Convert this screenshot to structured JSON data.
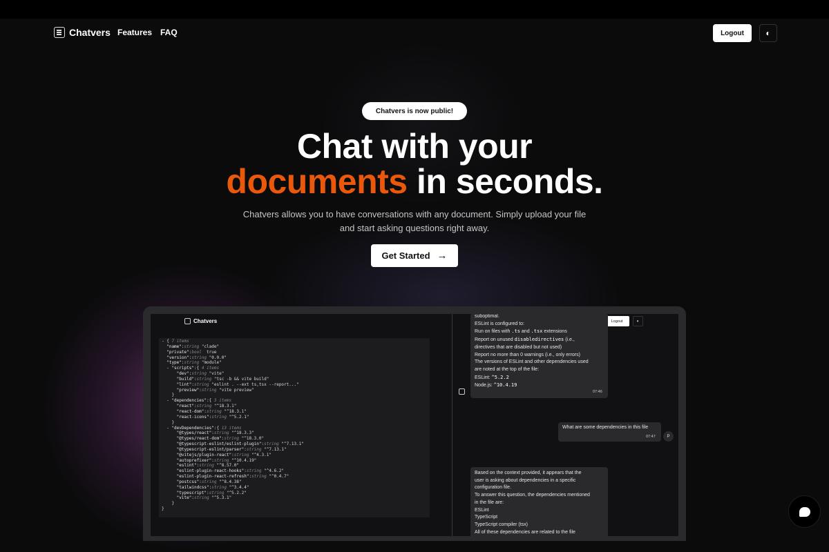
{
  "nav": {
    "brand": "Chatvers",
    "links": [
      "Features",
      "FAQ"
    ],
    "logout_label": "Logout",
    "theme_icon": "moon-sun-icon"
  },
  "hero": {
    "badge": "Chatvers is now public!",
    "title_line1": "Chat with your",
    "title_accent": "documents",
    "title_line2_rest": " in seconds.",
    "subtitle": "Chatvers allows you to have conversations with any document. Simply upload your file and start asking questions right away.",
    "cta_label": "Get Started",
    "accent_color": "#ea580c"
  },
  "preview": {
    "brand": "Chatvers",
    "logout_label": "Logout",
    "json_lines": [
      [
        {
          "c": "jl",
          "t": "- { "
        },
        {
          "c": "jc",
          "t": "7 items"
        }
      ],
      [
        {
          "c": "jk",
          "t": "  \"name\""
        },
        {
          "c": "jl",
          "t": ":"
        },
        {
          "c": "jt",
          "t": "string"
        },
        {
          "c": "jv",
          "t": "\"clade\""
        }
      ],
      [
        {
          "c": "jk",
          "t": "  \"private\""
        },
        {
          "c": "jl",
          "t": ":"
        },
        {
          "c": "jt",
          "t": "bool"
        },
        {
          "c": "jv",
          "t": " true"
        }
      ],
      [
        {
          "c": "jk",
          "t": "  \"version\""
        },
        {
          "c": "jl",
          "t": ":"
        },
        {
          "c": "jt",
          "t": "string"
        },
        {
          "c": "jv",
          "t": "\"0.0.0\""
        }
      ],
      [
        {
          "c": "jk",
          "t": "  \"type\""
        },
        {
          "c": "jl",
          "t": ":"
        },
        {
          "c": "jt",
          "t": "string"
        },
        {
          "c": "jv",
          "t": "\"module\""
        }
      ],
      [
        {
          "c": "jk",
          "t": "  - \"scripts\""
        },
        {
          "c": "jl",
          "t": ":{ "
        },
        {
          "c": "jc",
          "t": "4 items"
        }
      ],
      [
        {
          "c": "jk",
          "t": "      \"dev\""
        },
        {
          "c": "jl",
          "t": ":"
        },
        {
          "c": "jt",
          "t": "string"
        },
        {
          "c": "jv",
          "t": "\"vite\""
        }
      ],
      [
        {
          "c": "jk",
          "t": "      \"build\""
        },
        {
          "c": "jl",
          "t": ":"
        },
        {
          "c": "jt",
          "t": "string"
        },
        {
          "c": "jv",
          "t": "\"tsc -b && vite build\""
        }
      ],
      [
        {
          "c": "jk",
          "t": "      \"lint\""
        },
        {
          "c": "jl",
          "t": ":"
        },
        {
          "c": "jt",
          "t": "string"
        },
        {
          "c": "jv",
          "t": "\"eslint . --ext ts,tsx --report...\""
        }
      ],
      [
        {
          "c": "jk",
          "t": "      \"preview\""
        },
        {
          "c": "jl",
          "t": ":"
        },
        {
          "c": "jt",
          "t": "string"
        },
        {
          "c": "jv",
          "t": "\"vite preview\""
        }
      ],
      [
        {
          "c": "jl",
          "t": "    }"
        }
      ],
      [
        {
          "c": "jk",
          "t": "  - \"dependencies\""
        },
        {
          "c": "jl",
          "t": ":{ "
        },
        {
          "c": "jc",
          "t": "3 items"
        }
      ],
      [
        {
          "c": "jk",
          "t": "      \"react\""
        },
        {
          "c": "jl",
          "t": ":"
        },
        {
          "c": "jt",
          "t": "string"
        },
        {
          "c": "jv",
          "t": "\"^18.3.1\""
        }
      ],
      [
        {
          "c": "jk",
          "t": "      \"react-dom\""
        },
        {
          "c": "jl",
          "t": ":"
        },
        {
          "c": "jt",
          "t": "string"
        },
        {
          "c": "jv",
          "t": "\"^18.3.1\""
        }
      ],
      [
        {
          "c": "jk",
          "t": "      \"react-icons\""
        },
        {
          "c": "jl",
          "t": ":"
        },
        {
          "c": "jt",
          "t": "string"
        },
        {
          "c": "jv",
          "t": "\"^5.2.1\""
        }
      ],
      [
        {
          "c": "jl",
          "t": "    }"
        }
      ],
      [
        {
          "c": "jk",
          "t": "  - \"devDependencies\""
        },
        {
          "c": "jl",
          "t": ":{ "
        },
        {
          "c": "jc",
          "t": "13 items"
        }
      ],
      [
        {
          "c": "jk",
          "t": "      \"@types/react\""
        },
        {
          "c": "jl",
          "t": ":"
        },
        {
          "c": "jt",
          "t": "string"
        },
        {
          "c": "jv",
          "t": "\"^18.3.3\""
        }
      ],
      [
        {
          "c": "jk",
          "t": "      \"@types/react-dom\""
        },
        {
          "c": "jl",
          "t": ":"
        },
        {
          "c": "jt",
          "t": "string"
        },
        {
          "c": "jv",
          "t": "\"^18.3.0\""
        }
      ],
      [
        {
          "c": "jk",
          "t": "      \"@typescript-eslint/eslint-plugin\""
        },
        {
          "c": "jl",
          "t": ":"
        },
        {
          "c": "jt",
          "t": "string"
        },
        {
          "c": "jv",
          "t": "\"^7.13.1\""
        }
      ],
      [
        {
          "c": "jk",
          "t": "      \"@typescript-eslint/parser\""
        },
        {
          "c": "jl",
          "t": ":"
        },
        {
          "c": "jt",
          "t": "string"
        },
        {
          "c": "jv",
          "t": "\"^7.13.1\""
        }
      ],
      [
        {
          "c": "jk",
          "t": "      \"@vitejs/plugin-react\""
        },
        {
          "c": "jl",
          "t": ":"
        },
        {
          "c": "jt",
          "t": "string"
        },
        {
          "c": "jv",
          "t": "\"^4.3.1\""
        }
      ],
      [
        {
          "c": "jk",
          "t": "      \"autoprefixer\""
        },
        {
          "c": "jl",
          "t": ":"
        },
        {
          "c": "jt",
          "t": "string"
        },
        {
          "c": "jv",
          "t": "\"^10.4.19\""
        }
      ],
      [
        {
          "c": "jk",
          "t": "      \"eslint\""
        },
        {
          "c": "jl",
          "t": ":"
        },
        {
          "c": "jt",
          "t": "string"
        },
        {
          "c": "jv",
          "t": "\"^8.57.0\""
        }
      ],
      [
        {
          "c": "jk",
          "t": "      \"eslint-plugin-react-hooks\""
        },
        {
          "c": "jl",
          "t": ":"
        },
        {
          "c": "jt",
          "t": "string"
        },
        {
          "c": "jv",
          "t": "\"^4.6.2\""
        }
      ],
      [
        {
          "c": "jk",
          "t": "      \"eslint-plugin-react-refresh\""
        },
        {
          "c": "jl",
          "t": ":"
        },
        {
          "c": "jt",
          "t": "string"
        },
        {
          "c": "jv",
          "t": "\"^0.4.7\""
        }
      ],
      [
        {
          "c": "jk",
          "t": "      \"postcss\""
        },
        {
          "c": "jl",
          "t": ":"
        },
        {
          "c": "jt",
          "t": "string"
        },
        {
          "c": "jv",
          "t": "\"^8.4.38\""
        }
      ],
      [
        {
          "c": "jk",
          "t": "      \"tailwindcss\""
        },
        {
          "c": "jl",
          "t": ":"
        },
        {
          "c": "jt",
          "t": "string"
        },
        {
          "c": "jv",
          "t": "\"^3.4.4\""
        }
      ],
      [
        {
          "c": "jk",
          "t": "      \"typescript\""
        },
        {
          "c": "jl",
          "t": ":"
        },
        {
          "c": "jt",
          "t": "string"
        },
        {
          "c": "jv",
          "t": "\"^5.2.2\""
        }
      ],
      [
        {
          "c": "jk",
          "t": "      \"vite\""
        },
        {
          "c": "jl",
          "t": ":"
        },
        {
          "c": "jt",
          "t": "string"
        },
        {
          "c": "jv",
          "t": "\"^5.3.1\""
        }
      ],
      [
        {
          "c": "jl",
          "t": "    }"
        }
      ],
      [
        {
          "c": "jl",
          "t": "}"
        }
      ]
    ],
    "bot_message_1": [
      "suboptimal.",
      "ESLint is configured to:",
      "Run on files with [.ts] and [.tsx] extensions",
      "Report on unused [disabledirectives] (i.e.,",
      "directives that are disabled but not used)",
      "Report no more than 0 warnings (i.e., only errors)",
      "The versions of ESLint and other dependencies used",
      "are noted at the top of the file:",
      "ESLint: [^5.2.2]",
      "Node.js: [^10.4.19]"
    ],
    "bot_time_1": "07:46",
    "user_message": "What are some dependencies in this file",
    "user_time": "07:47",
    "user_avatar": "P",
    "bot_message_2": [
      "Based on the context provided, it appears that the",
      "user is asking about dependencies in a specific",
      "configuration file.",
      "To answer this question, the dependencies mentioned",
      "in the file are:",
      "ESLint",
      "TypeScript",
      "TypeScript compiler (tsx)",
      "All of these dependencies are related to the file"
    ]
  }
}
